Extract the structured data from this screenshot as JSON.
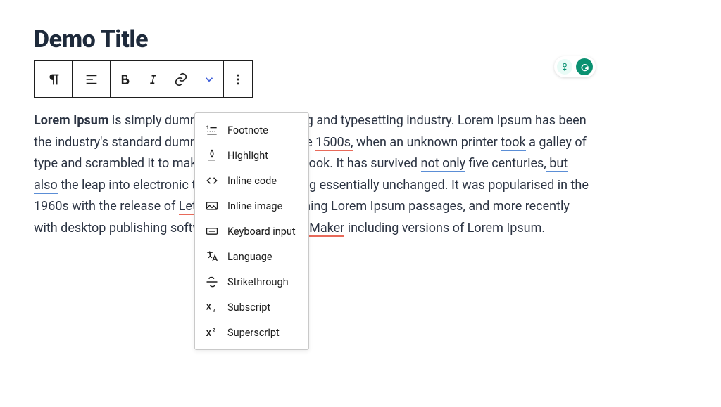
{
  "title": "Demo Title",
  "paragraph": {
    "strong_lead": "Lorem Ipsum",
    "seg1": " is simply dummy text of the printing and typesetting industry. Lorem Ipsum has been the industry's standard dummy text ever since the ",
    "year1": "1500s,",
    "seg2": " when an unknown printer ",
    "took": "took",
    "seg3": " a galley of type and scrambled it to make a type specimen book. It has survived ",
    "not_only": "not only",
    "seg4": " five centuries,",
    "but_also": " but also",
    "seg5": " the leap into electronic typesetting, remaining essentially unchanged. It was popularised in the 1960s with the release of ",
    "letraset": "Letraset",
    "seg6": " sheets containing Lorem Ipsum passages, and more recently with desktop publishing software like ",
    "aldus": "Aldus PageMaker",
    "seg7": " including versions of Lorem Ipsum."
  },
  "menu": {
    "items": [
      {
        "label": "Footnote"
      },
      {
        "label": "Highlight"
      },
      {
        "label": "Inline code"
      },
      {
        "label": "Inline image"
      },
      {
        "label": "Keyboard input"
      },
      {
        "label": "Language"
      },
      {
        "label": "Strikethrough"
      },
      {
        "label": "Subscript"
      },
      {
        "label": "Superscript"
      }
    ]
  }
}
